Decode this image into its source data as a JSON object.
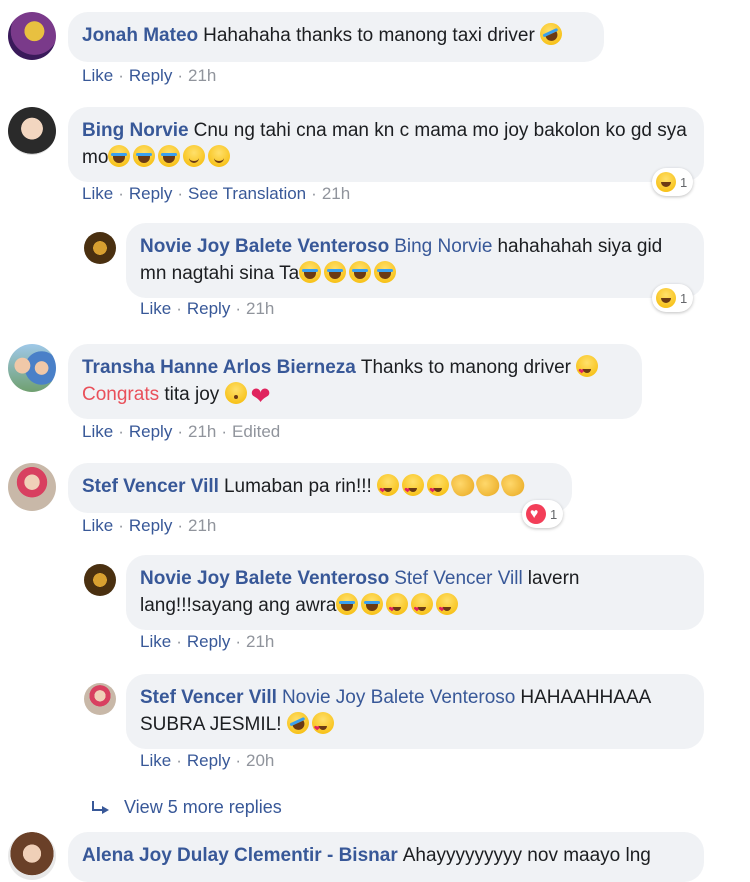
{
  "actions": {
    "like": "Like",
    "reply": "Reply",
    "see_translation": "See Translation",
    "edited": "Edited",
    "sep": "·"
  },
  "comments": [
    {
      "author": "Jonah Mateo",
      "text": "Hahahaha thanks to manong taxi driver",
      "time": "21h"
    },
    {
      "author": "Bing Norvie",
      "text": "Cnu ng tahi cna man kn c mama mo joy bakolon ko gd sya mo",
      "time": "21h",
      "reaction_count": "1"
    },
    {
      "author": "Novie Joy Balete Venteroso",
      "tag": "Bing Norvie",
      "text": "hahahahah siya gid mn nagtahi sina Ta",
      "time": "21h",
      "reaction_count": "1"
    },
    {
      "author": "Transha Hanne Arlos Bierneza",
      "text": "Thanks to manong driver",
      "highlight": "Congrats",
      "text2": "tita joy",
      "time": "21h"
    },
    {
      "author": "Stef Vencer Vill",
      "text": "Lumaban pa rin!!!",
      "time": "21h",
      "reaction_count": "1"
    },
    {
      "author": "Novie Joy Balete Venteroso",
      "tag": "Stef Vencer Vill",
      "text": "lavern lang!!!sayang ang awra",
      "time": "21h"
    },
    {
      "author": "Stef Vencer Vill",
      "tag": "Novie Joy Balete Venteroso",
      "text": "HAHAAHHAAA SUBRA JESMIL!",
      "time": "20h"
    },
    {
      "author": "Alena Joy Dulay Clementir - Bisnar",
      "text": "Ahayyyyyyyyy nov maayo lng"
    }
  ],
  "view_more": "View 5 more replies",
  "colors": {
    "link": "#385898",
    "bubble": "#f0f2f5",
    "meta": "#90949c",
    "highlight": "#e9505a"
  },
  "icons": [
    "rofl-emoji",
    "laughing-tears-emoji",
    "smile-emoji",
    "heart-eyes-emoji",
    "kiss-emoji",
    "red-heart-emoji",
    "clap-emoji",
    "haha-reaction-icon",
    "love-reaction-icon",
    "reply-arrow-icon"
  ]
}
